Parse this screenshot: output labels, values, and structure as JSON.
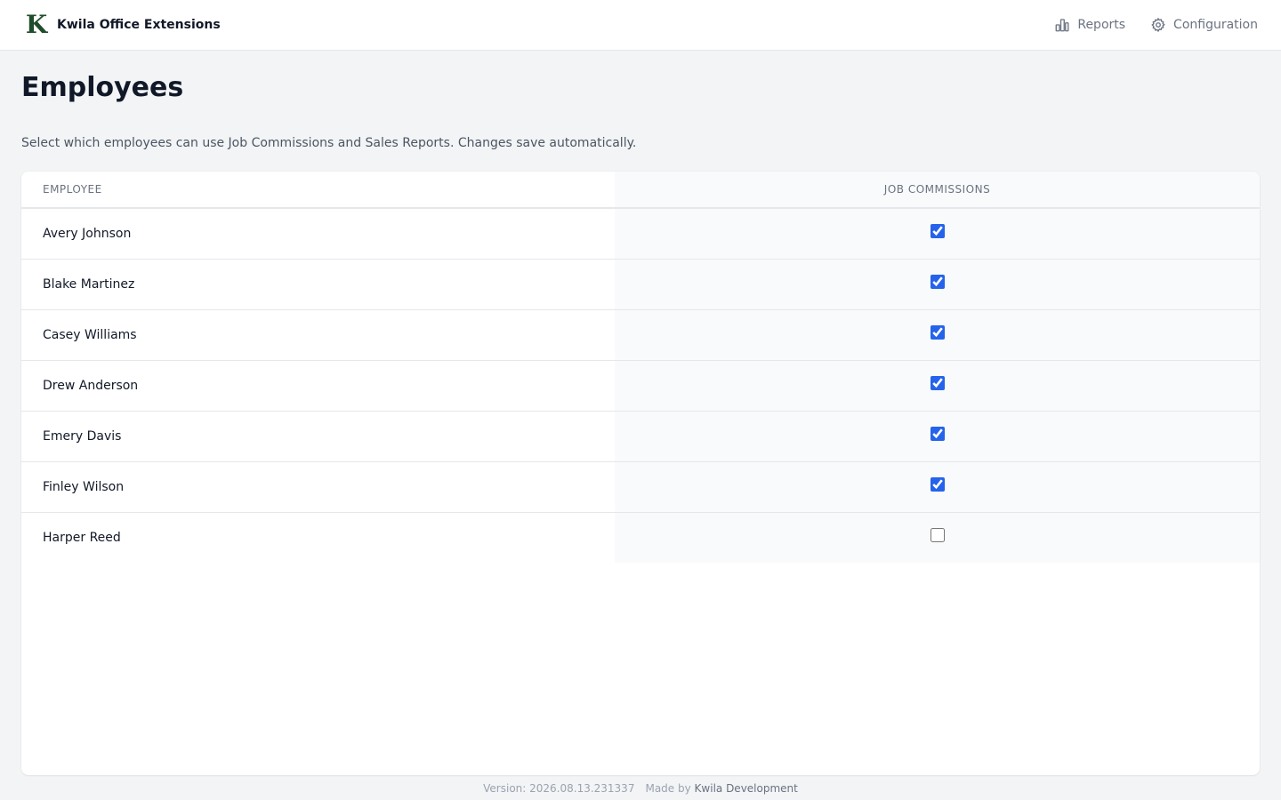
{
  "header": {
    "logo_letter": "K",
    "app_name": "Kwila Office Extensions",
    "nav": [
      {
        "label": "Reports",
        "icon": "bar-chart-icon"
      },
      {
        "label": "Configuration",
        "icon": "gear-icon"
      }
    ]
  },
  "page": {
    "title": "Employees",
    "description": "Select which employees can use Job Commissions and Sales Reports. Changes save automatically."
  },
  "table": {
    "columns": [
      "Employee",
      "Job Commissions"
    ],
    "rows": [
      {
        "name": "Avery Johnson",
        "job_commissions": true
      },
      {
        "name": "Blake Martinez",
        "job_commissions": true
      },
      {
        "name": "Casey Williams",
        "job_commissions": true
      },
      {
        "name": "Drew Anderson",
        "job_commissions": true
      },
      {
        "name": "Emery Davis",
        "job_commissions": true
      },
      {
        "name": "Finley Wilson",
        "job_commissions": true
      },
      {
        "name": "Harper Reed",
        "job_commissions": false
      }
    ]
  },
  "footer": {
    "version": "Version: 2026.08.13.231337",
    "made_by": "Made by",
    "developer": "Kwila Development"
  },
  "colors": {
    "accent": "#2563eb",
    "logo": "#1f4d2b",
    "background": "#f3f4f6"
  }
}
